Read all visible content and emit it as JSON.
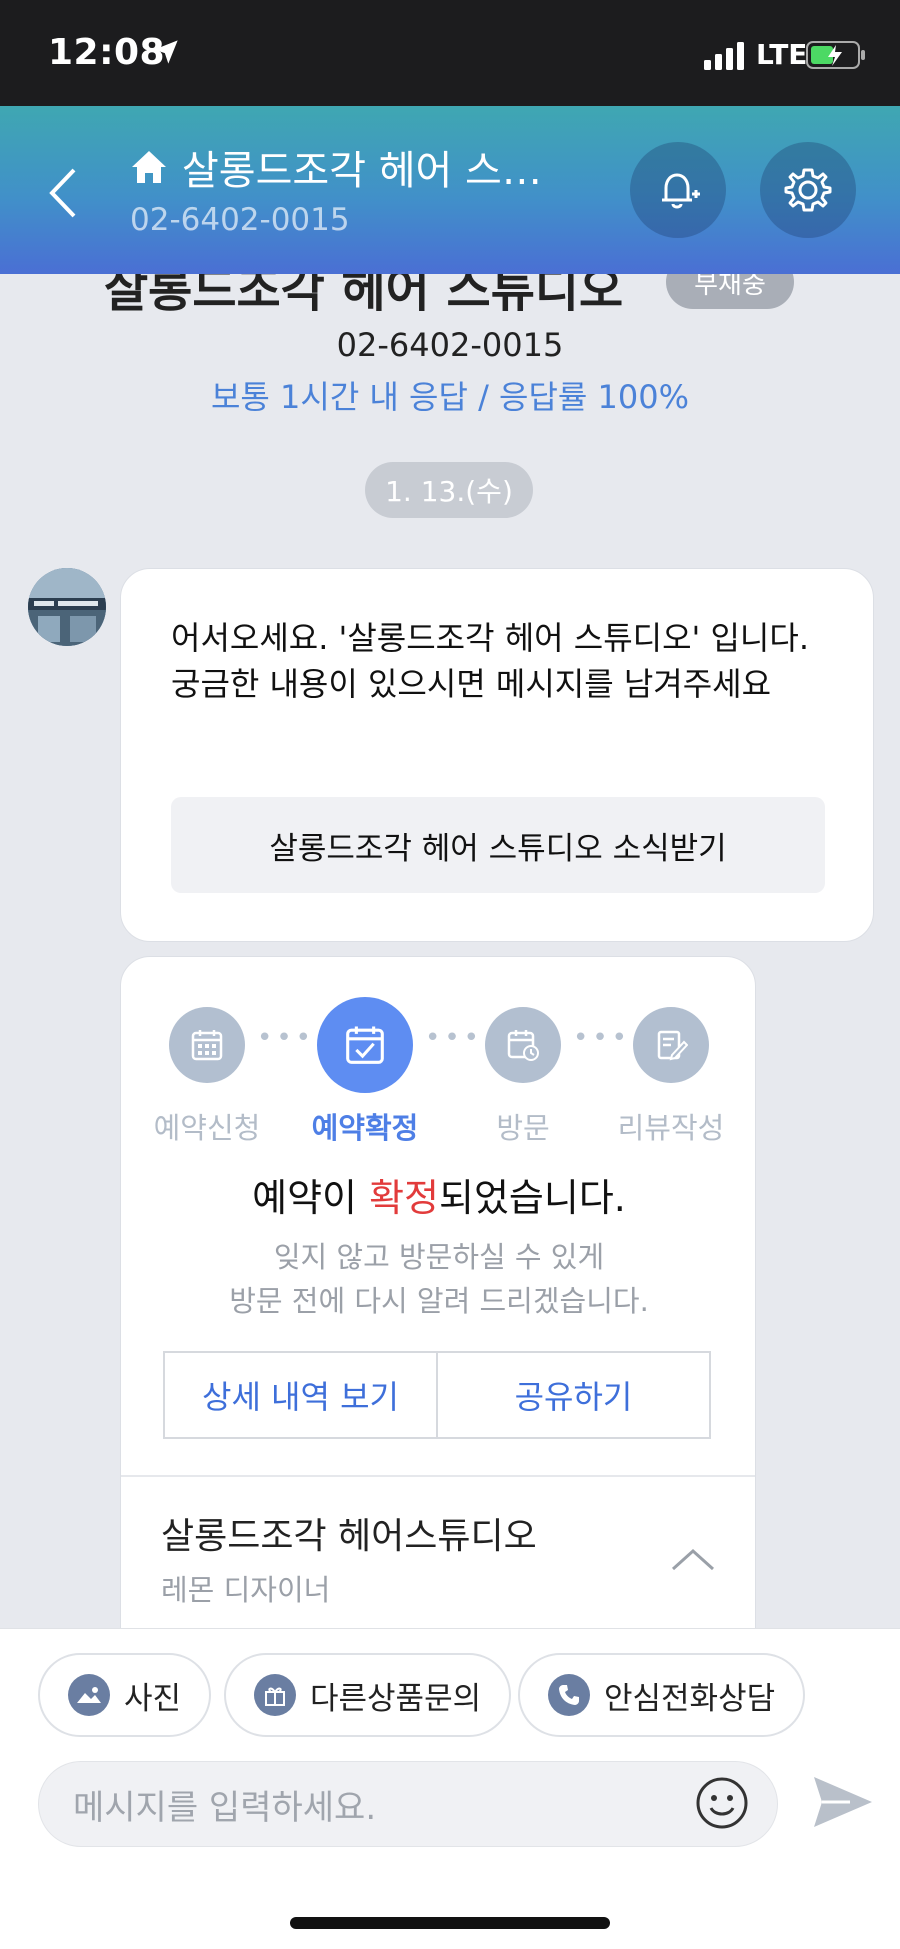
{
  "status_bar": {
    "time": "12:08",
    "network": "LTE"
  },
  "header": {
    "title": "살롱드조각 헤어 스…",
    "phone": "02-6402-0015"
  },
  "profile": {
    "name": "살롱드조각 헤어 스튜디오",
    "status_badge": "부재중",
    "phone": "02-6402-0015",
    "response_info": "보통 1시간 내 응답 / 응답률 100%"
  },
  "date_divider": "1. 13.(수)",
  "welcome_message": {
    "line1": "어서오세요. '살롱드조각 헤어 스튜디오' 입니다.",
    "line2": "궁금한 내용이 있으시면 메시지를 남겨주세요",
    "news_button": "살롱드조각 헤어 스튜디오 소식받기"
  },
  "reservation_card": {
    "steps": [
      {
        "label": "예약신청",
        "icon": "calendar-icon",
        "active": false
      },
      {
        "label": "예약확정",
        "icon": "calendar-check-icon",
        "active": true
      },
      {
        "label": "방문",
        "icon": "calendar-clock-icon",
        "active": false
      },
      {
        "label": "리뷰작성",
        "icon": "edit-icon",
        "active": false
      }
    ],
    "title_prefix": "예약이 ",
    "title_highlight": "확정",
    "title_suffix": "되었습니다.",
    "subtitle_line1": "잊지 않고 방문하실 수 있게",
    "subtitle_line2": "방문 전에 다시 알려 드리겠습니다.",
    "detail_button": "상세 내역 보기",
    "share_button": "공유하기",
    "salon_name": "살롱드조각 헤어스튜디오",
    "designer": "레몬 디자이너"
  },
  "quick_actions": [
    {
      "label": "사진",
      "icon": "photo-icon"
    },
    {
      "label": "다른상품문의",
      "icon": "gift-icon"
    },
    {
      "label": "안심전화상담",
      "icon": "phone-icon"
    }
  ],
  "input": {
    "placeholder": "메시지를 입력하세요."
  },
  "colors": {
    "accent_blue": "#5e8df2",
    "highlight_red": "#e23b3b",
    "header_gradient_top": "#3fa7b2",
    "header_gradient_bottom": "#4a6fd4"
  }
}
